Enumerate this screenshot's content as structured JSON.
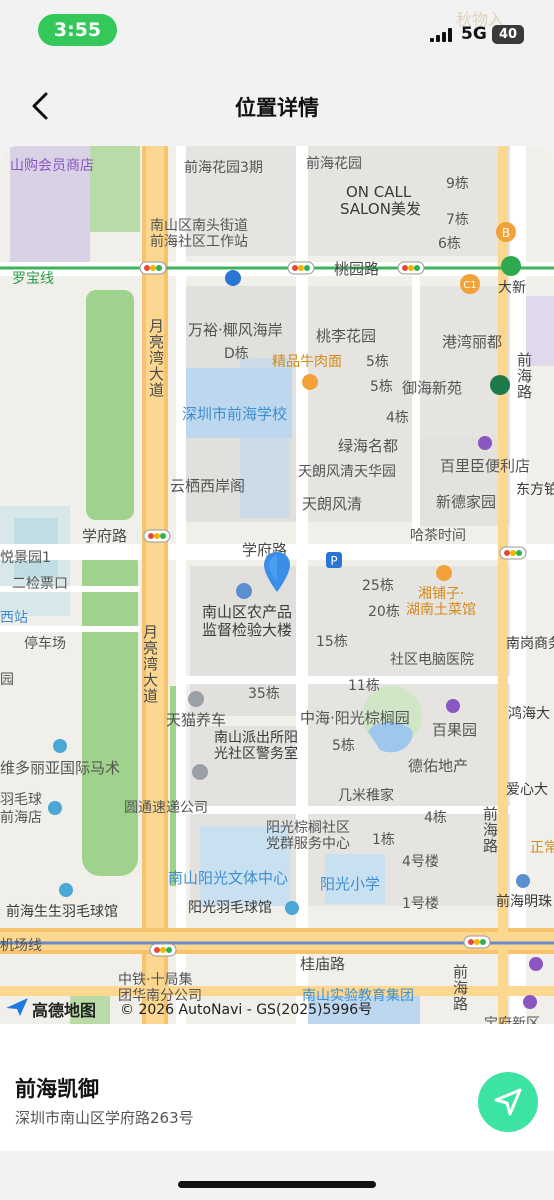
{
  "status_bar": {
    "time": "3:55",
    "network": "5G",
    "battery": "40",
    "watermark": "秋物入"
  },
  "nav": {
    "title": "位置详情"
  },
  "map": {
    "labels": {
      "shanpao": "山购会员商店",
      "qianhai_garden": "前海花园3期",
      "qianhai_hua": "前海花园",
      "on_call": "ON CALL",
      "salon": "SALON美发",
      "b9": "9栋",
      "b7": "7栋",
      "b6": "6栋",
      "nantou_street": "南山区南头街道",
      "qianhai_station": "前海社区工作站",
      "luobao": "罗宝线",
      "taoyuan_road": "桃园路",
      "daxin": "大新",
      "wanyu": "万裕·椰风海岸",
      "taoli": "桃李花园",
      "gangwan": "港湾丽都",
      "dong_d": "D栋",
      "beef": "精品牛肉面",
      "b5a": "5栋",
      "b5b": "5栋",
      "yuhai": "御海新苑",
      "shenzhen_school": "深圳市前海学校",
      "b4a": "4栋",
      "lvhai": "绿海名都",
      "tianlang_huating": "天朗风清天华园",
      "baili": "百里臣便利店",
      "yunqi": "云栖西岸阁",
      "tianlang": "天朗风清",
      "xinde": "新德家园",
      "dongfang": "东方铂",
      "xuefu_road_w": "学府路",
      "hacha": "哈茶时间",
      "xuefu_road": "学府路",
      "yuejing": "悦景园1",
      "erjian": "二检票口",
      "parking": "停车场",
      "west_station": "西站",
      "b25": "25栋",
      "b20": "20栋",
      "xiangpuzi1": "湘铺子·",
      "xiangpuzi2": "湖南土菜馆",
      "agri1": "南山区农产品",
      "agri2": "监督检验大楼",
      "b15": "15栋",
      "community_pc": "社区电脑医院",
      "nangang": "南岗商务",
      "yuan_fragment": "园",
      "b35": "35栋",
      "b11": "11栋",
      "tmall": "天猫养车",
      "zhonghai": "中海·阳光棕榈园",
      "baiguo": "百果园",
      "honghai": "鸿海大",
      "police1": "南山派出所阳",
      "police2": "光社区警务室",
      "b5c": "5栋",
      "deyou": "德佑地产",
      "weiduoliya": "维多丽亚国际马术",
      "jimi": "几米稚家",
      "aixin": "爱心大",
      "badminton_a": "羽毛球",
      "qianhai_shop": "前海店",
      "yuantong": "圆通速递公司",
      "b4b": "4栋",
      "yangguang_community1": "阳光棕榈社区",
      "yangguang_community2": "党群服务中心",
      "b1a": "1栋",
      "zhengcheng": "正常",
      "b4c": "4号楼",
      "nanshan_culture": "南山阳光文体中心",
      "yangguang_school": "阳光小学",
      "qianhai_mingyue": "前海明珠",
      "qianhai_badminton": "前海生生羽毛球馆",
      "yangguang_badminton": "阳光羽毛球馆",
      "b1b": "1号楼",
      "airport_line": "机场线",
      "guimiao_road": "桂庙路",
      "zhongtie1": "中铁·十局集",
      "zhongtie2": "团华南分公司",
      "nanshan_edu": "南山实验教育集团",
      "zongfu": "宝府新区",
      "yueliangwan1": "月亮湾大道",
      "yueliangwan2": "月亮湾大道",
      "qianhai_road1": "前海路",
      "qianhai_road2": "前海路",
      "qianhai_road3": "前海路"
    },
    "attribution": {
      "brand": "高德地图",
      "copyright": "© 2026 AutoNavi - GS(2025)5996号"
    }
  },
  "place": {
    "name": "前海凯御",
    "address": "深圳市南山区学府路263号"
  }
}
